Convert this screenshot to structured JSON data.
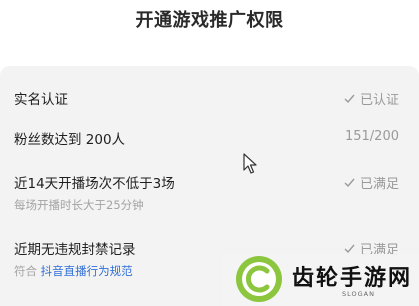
{
  "page_title": "开通游戏推广权限",
  "requirements": [
    {
      "label": "实名认证",
      "status": "已认证",
      "status_icon": "check-icon"
    },
    {
      "label": "粉丝数达到 200人",
      "progress_text": "151/200"
    },
    {
      "label": "近14天开播场次不低于3场",
      "status": "已满足",
      "status_icon": "check-icon",
      "sub": "每场开播时长大于25分钟"
    },
    {
      "label": "近期无违规封禁记录",
      "status": "已满足",
      "status_icon": "check-icon",
      "sub_prefix": "符合",
      "sub_link": "抖音直播行为规范"
    }
  ],
  "watermark": {
    "name": "齿轮手游网",
    "slogan": "SLOGAN"
  },
  "colors": {
    "card_background": "#f3f3f3",
    "link": "#2f6fd8",
    "status_grey": "#9a9a9a",
    "logo_green": "#8cc63f"
  }
}
